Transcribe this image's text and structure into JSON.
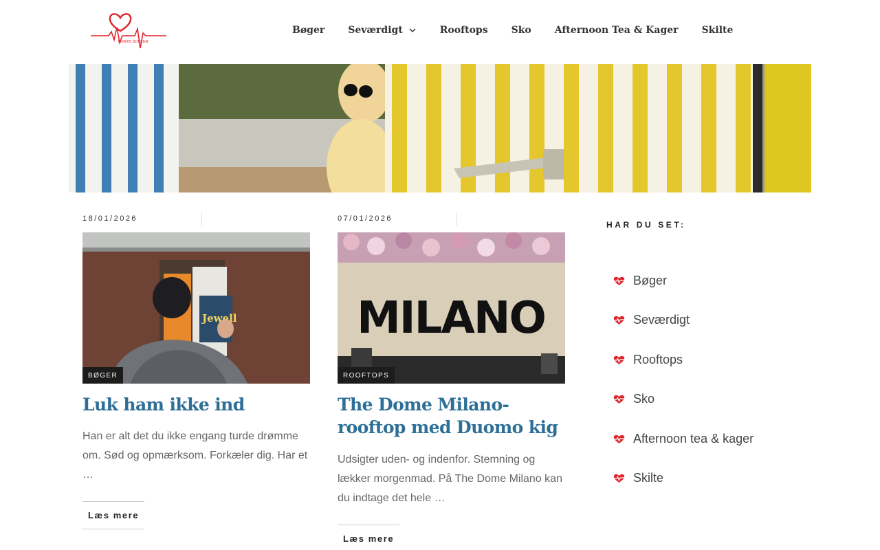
{
  "logo": {
    "text": "TENNIS SOKKER"
  },
  "nav": [
    {
      "label": "Bøger",
      "has_dropdown": false
    },
    {
      "label": "Seværdigt",
      "has_dropdown": true
    },
    {
      "label": "Rooftops",
      "has_dropdown": false
    },
    {
      "label": "Sko",
      "has_dropdown": false
    },
    {
      "label": "Afternoon Tea & Kager",
      "has_dropdown": false
    },
    {
      "label": "Skilte",
      "has_dropdown": false
    }
  ],
  "posts": [
    {
      "date": "18/01/2026",
      "category": "BØGER",
      "title": "Luk ham ikke ind",
      "excerpt": "Han er alt det du ikke engang turde drømme om. Sød og opmærksom. Forkæler dig. Har et …",
      "read_more": "Læs mere",
      "image_text": "Jewell"
    },
    {
      "date": "07/01/2026",
      "category": "ROOFTOPS",
      "title": "The Dome Milano- rooftop med Duomo kig",
      "excerpt": "Udsigter uden- og indenfor. Stemning og lækker morgenmad. På The Dome Milano kan du indtage det hele …",
      "read_more": "Læs mere",
      "image_text": "MILANO"
    }
  ],
  "sidebar": {
    "title": "HAR DU SET:",
    "items": [
      "Bøger",
      "Seværdigt",
      "Rooftops",
      "Sko",
      "Afternoon tea & kager",
      "Skilte"
    ]
  },
  "colors": {
    "accent": "#2d6f97",
    "brand_red": "#e0242c",
    "badge_bg": "#1c1c1c"
  }
}
